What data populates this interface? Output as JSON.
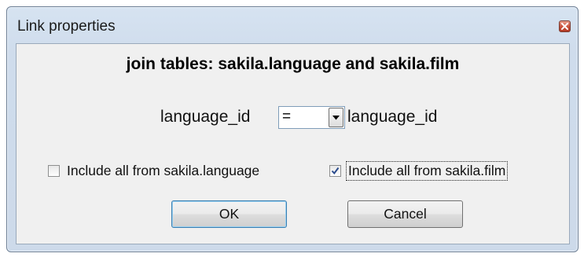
{
  "window": {
    "title": "Link properties",
    "close_icon": "close-icon"
  },
  "dialog": {
    "heading": "join tables: sakila.language and sakila.film",
    "left_field": "language_id",
    "operator": {
      "selected": "=",
      "dropdown_icon": "chevron-down-icon"
    },
    "right_field": "language_id",
    "include_left": {
      "label": "Include all from sakila.language",
      "checked": false
    },
    "include_right": {
      "label": "Include all from sakila.film",
      "checked": true,
      "focused": true
    },
    "ok_label": "OK",
    "cancel_label": "Cancel"
  },
  "colors": {
    "frame": "#cfdcec",
    "close_button": "#c9503a",
    "check_mark": "#2a4b8d",
    "default_button_border": "#3c7fb1"
  }
}
